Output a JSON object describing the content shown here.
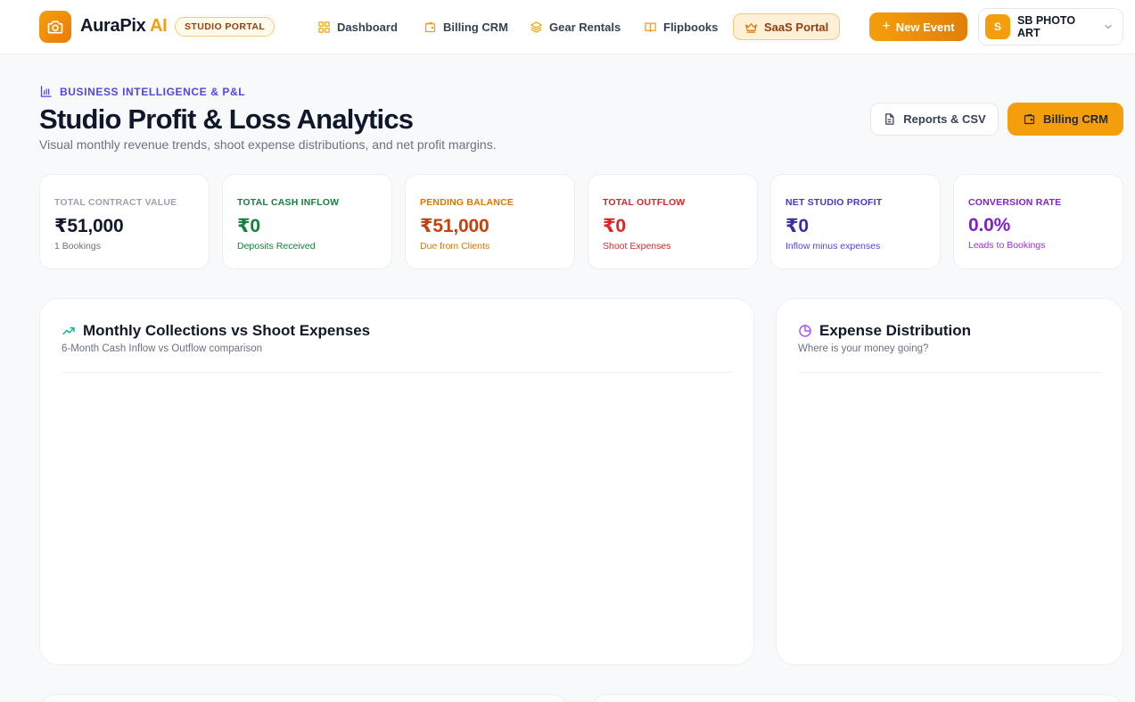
{
  "brand": {
    "name": "AuraPix",
    "ai": "AI",
    "badge": "STUDIO PORTAL"
  },
  "nav": {
    "items": [
      {
        "label": "Dashboard",
        "icon": "grid-icon"
      },
      {
        "label": "Billing CRM",
        "icon": "wallet-icon"
      },
      {
        "label": "Gear Rentals",
        "icon": "layers-icon"
      },
      {
        "label": "Flipbooks",
        "icon": "book-icon"
      },
      {
        "label": "SaaS Portal",
        "icon": "crown-icon",
        "active": true
      }
    ],
    "new_event": "New Event",
    "user": {
      "initial": "S",
      "name": "SB PHOTO ART"
    }
  },
  "header": {
    "eyebrow": "BUSINESS INTELLIGENCE & P&L",
    "title": "Studio Profit & Loss Analytics",
    "subtitle": "Visual monthly revenue trends, shoot expense distributions, and net profit margins.",
    "reports_button": "Reports & CSV",
    "billing_button": "Billing CRM"
  },
  "stats": [
    {
      "label": "TOTAL CONTRACT VALUE",
      "value": "₹51,000",
      "sub": "1 Bookings",
      "label_color": "#9ca3af",
      "value_color": "#111827",
      "sub_color": "#6b7280"
    },
    {
      "label": "TOTAL CASH INFLOW",
      "value": "₹0",
      "sub": "Deposits Received",
      "label_color": "#15803d",
      "value_color": "#15803d",
      "sub_color": "#15803d"
    },
    {
      "label": "PENDING BALANCE",
      "value": "₹51,000",
      "sub": "Due from Clients",
      "label_color": "#d97706",
      "value_color": "#c2410c",
      "sub_color": "#d97706"
    },
    {
      "label": "TOTAL OUTFLOW",
      "value": "₹0",
      "sub": "Shoot Expenses",
      "label_color": "#dc2626",
      "value_color": "#dc2626",
      "sub_color": "#dc2626"
    },
    {
      "label": "NET STUDIO PROFIT",
      "value": "₹0",
      "sub": "Inflow minus expenses",
      "label_color": "#4338ca",
      "value_color": "#3730a3",
      "sub_color": "#4f46e5"
    },
    {
      "label": "CONVERSION RATE",
      "value": "0.0%",
      "sub": "Leads to Bookings",
      "label_color": "#7e22ce",
      "value_color": "#7e22ce",
      "sub_color": "#9333ea"
    }
  ],
  "panels": {
    "collections": {
      "title": "Monthly Collections vs Shoot Expenses",
      "subtitle": "6-Month Cash Inflow vs Outflow comparison"
    },
    "distribution": {
      "title": "Expense Distribution",
      "subtitle": "Where is your money going?"
    }
  }
}
